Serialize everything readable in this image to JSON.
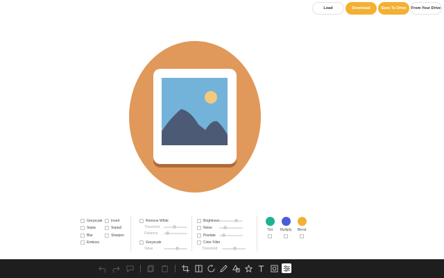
{
  "header": {
    "load_label": "Load",
    "download_label": "Download",
    "save_label": "Save To Drive",
    "from_drive_label": "From Your Drive"
  },
  "colors": {
    "accent": "#f4b032",
    "canvas_circle": "#e0995a",
    "toolbar_bg": "#1e1e1e",
    "tint": "#1bb394",
    "multiply": "#4b5bd8",
    "blend": "#f4b032"
  },
  "filters": {
    "basic": [
      "Greyscale",
      "Invert",
      "Sepia",
      "Sepia2",
      "Blur",
      "Sharpen",
      "Emboss"
    ],
    "remove_white": {
      "label": "Remove White",
      "threshold_label": "Threshold",
      "distance_label": "Distance",
      "threshold_value": 0.45,
      "distance_value": 0.1
    },
    "grayscale2": {
      "label": "Greyscale",
      "value_label": "Value",
      "value": 0.6
    },
    "adjust": {
      "brightness_label": "Brightness",
      "brightness_value": 0.75,
      "noise_label": "Noise",
      "noise_value": 0.2,
      "pixelate_label": "Pixelate",
      "pixelate_value": 0.15,
      "color_filter_label": "Color Filter",
      "threshold_label": "Threshold",
      "threshold_value": 0.55
    },
    "blend_modes": {
      "tint_label": "Tint",
      "multiply_label": "Multiply",
      "blend_label": "Blend"
    }
  },
  "toolbar": {
    "icons": [
      "undo-icon",
      "redo-icon",
      "comment-icon",
      "copy-icon",
      "paste-icon",
      "crop-icon",
      "flip-icon",
      "rotate-icon",
      "draw-icon",
      "shapes-icon",
      "star-icon",
      "text-icon",
      "mask-icon",
      "filter-icon"
    ]
  }
}
